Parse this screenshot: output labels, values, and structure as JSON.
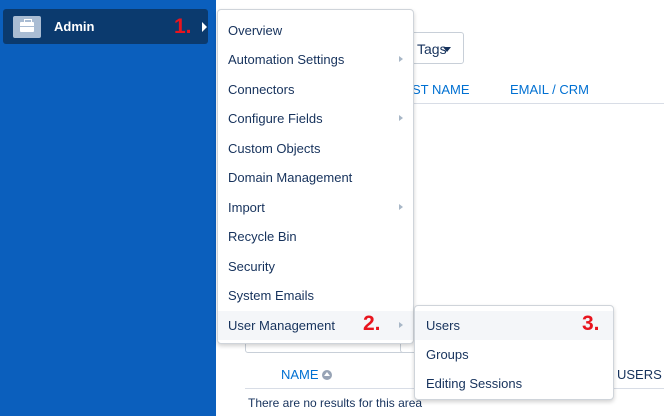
{
  "sidebar": {
    "admin_label": "Admin",
    "admin_icon": "briefcase-icon"
  },
  "steps": {
    "one": "1.",
    "two": "2.",
    "three": "3."
  },
  "background": {
    "tags_label": "Tags",
    "columns": [
      "ST NAME",
      "EMAIL / CRM"
    ],
    "table_name_col": "NAME",
    "table_users_col": "USERS",
    "no_results": "There are no results for this area"
  },
  "menu": {
    "items": [
      {
        "label": "Overview",
        "submenu": false
      },
      {
        "label": "Automation Settings",
        "submenu": true
      },
      {
        "label": "Connectors",
        "submenu": false
      },
      {
        "label": "Configure Fields",
        "submenu": true
      },
      {
        "label": "Custom Objects",
        "submenu": false
      },
      {
        "label": "Domain Management",
        "submenu": false
      },
      {
        "label": "Import",
        "submenu": true
      },
      {
        "label": "Recycle Bin",
        "submenu": false
      },
      {
        "label": "Security",
        "submenu": false
      },
      {
        "label": "System Emails",
        "submenu": false
      },
      {
        "label": "User Management",
        "submenu": true
      }
    ]
  },
  "submenu": {
    "items": [
      {
        "label": "Users"
      },
      {
        "label": "Groups"
      },
      {
        "label": "Editing Sessions"
      }
    ]
  },
  "colors": {
    "sidebar": "#0b5fbd",
    "sidebar_active": "#0b3a6e",
    "step_annotation": "#e8141e",
    "link": "#0070d2"
  }
}
